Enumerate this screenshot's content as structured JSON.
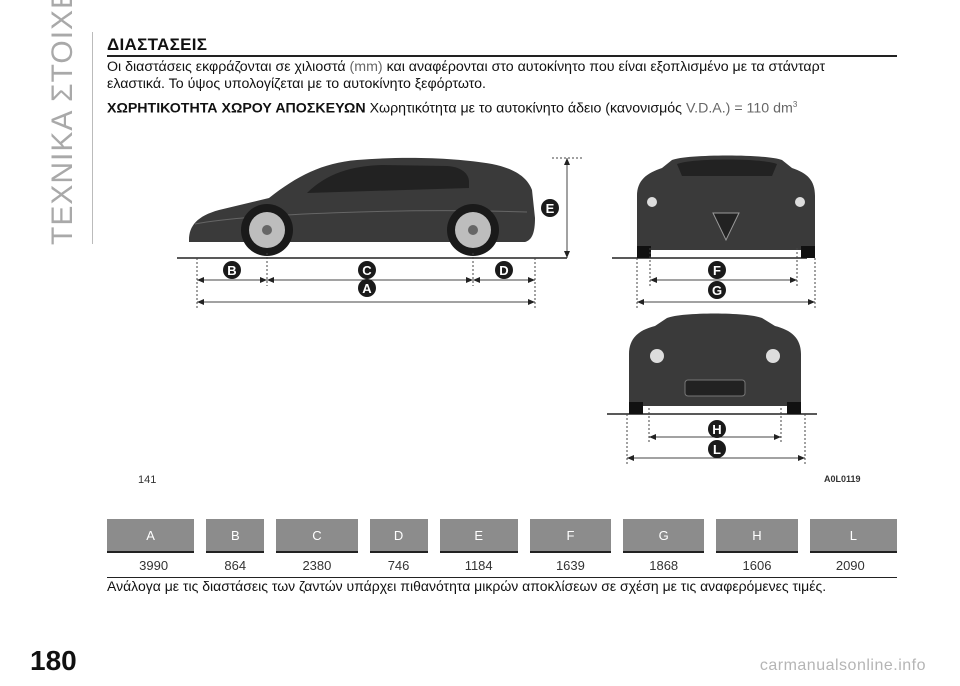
{
  "sidebar": {
    "title": "ΤΕΧΝΙΚΑ ΣΤΟΙΧΕΙΑ"
  },
  "section": {
    "title": "ΔΙΑΣΤΑΣΕΙΣ",
    "intro_part1": "Οι διαστάσεις εκφράζονται σε χιλιοστά",
    "intro_unit": "(mm)",
    "intro_part2": "και αναφέρονται στο αυτοκίνητο που είναι εξοπλισμένο με τα στάνταρτ",
    "intro_line2": "ελαστικά. Το ύψος υπολογίζεται με το αυτοκίνητο ξεφόρτωτο.",
    "capacity_label": "ΧΩΡΗΤΙΚΟΤΗΤΑ ΧΩΡΟΥ ΑΠΟΣΚΕΥΩΝ",
    "capacity_text": "Χωρητικότητα με το αυτοκίνητο άδειο (κανονισμός",
    "capacity_value": "V.D.A.) = 110 dm",
    "capacity_unit_exp": "3"
  },
  "figure": {
    "number": "141",
    "code": "A0L0119",
    "badges": [
      "A",
      "B",
      "C",
      "D",
      "E",
      "F",
      "G",
      "H",
      "L"
    ]
  },
  "dimensions": {
    "headers": [
      "A",
      "B",
      "C",
      "D",
      "E",
      "F",
      "G",
      "H",
      "L"
    ],
    "values": [
      "3990",
      "864",
      "2380",
      "746",
      "1184",
      "1639",
      "1868",
      "1606",
      "2090"
    ]
  },
  "footnote": "Ανάλογα με τις διαστάσεις των ζαντών υπάρχει πιθανότητα μικρών αποκλίσεων σε σχέση με τις αναφερόμενες τιμές.",
  "page": {
    "number": "180"
  },
  "watermark": "carmanualsonline.info"
}
